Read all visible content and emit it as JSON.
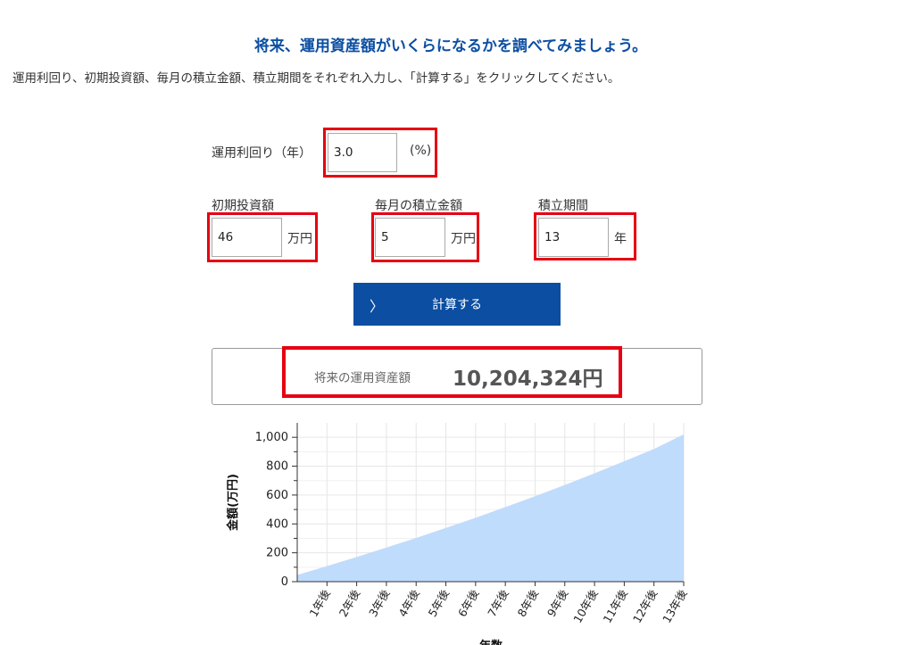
{
  "header": {
    "title": "将来、運用資産額がいくらになるかを調べてみましょう。",
    "instruction": "運用利回り、初期投資額、毎月の積立金額、積立期間をそれぞれ入力し、「計算する」をクリックしてください。"
  },
  "form": {
    "rate": {
      "label": "運用利回り（年）",
      "value": "3.0",
      "unit": "(%)"
    },
    "initial": {
      "label": "初期投資額",
      "value": "46",
      "unit": "万円"
    },
    "monthly": {
      "label": "毎月の積立金額",
      "value": "5",
      "unit": "万円"
    },
    "period": {
      "label": "積立期間",
      "value": "13",
      "unit": "年"
    }
  },
  "button": {
    "label": "計算する",
    "icon": "chevron-right-icon"
  },
  "result": {
    "label": "将来の運用資産額",
    "value": "10,204,324円"
  },
  "colors": {
    "accent": "#0b4ea2",
    "highlight": "#e60012",
    "area": "#c0dcfc"
  },
  "chart_data": {
    "type": "area",
    "categories": [
      "1年後",
      "2年後",
      "3年後",
      "4年後",
      "5年後",
      "6年後",
      "7年後",
      "8年後",
      "9年後",
      "10年後",
      "11年後",
      "12年後",
      "13年後"
    ],
    "x": [
      0,
      1,
      2,
      3,
      4,
      5,
      6,
      7,
      8,
      9,
      10,
      11,
      12,
      13
    ],
    "values": [
      46,
      108,
      171,
      236,
      303,
      372,
      443,
      517,
      592,
      670,
      751,
      834,
      919,
      1020
    ],
    "ylabel": "金額(万円)",
    "xlabel": "年数",
    "yticks": [
      0,
      200,
      400,
      600,
      800,
      1000
    ],
    "ytick_labels": [
      "0",
      "200",
      "400",
      "600",
      "800",
      "1,000"
    ],
    "ylim": [
      0,
      1100
    ],
    "grid": true
  }
}
